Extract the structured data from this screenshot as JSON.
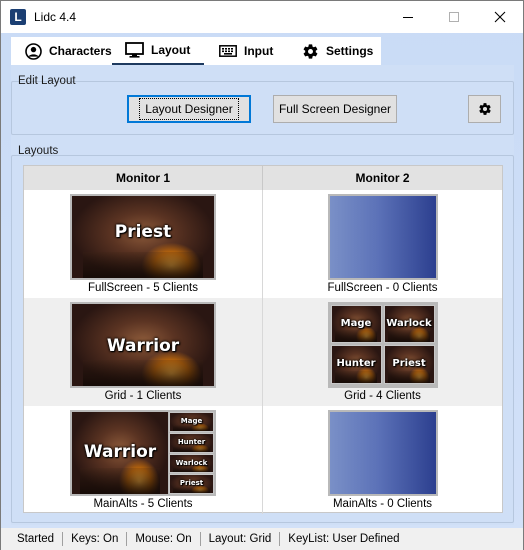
{
  "window": {
    "title": "Lidc 4.4",
    "app_icon_letter": "L"
  },
  "tabs": [
    {
      "label": "Characters",
      "icon": "user-circle-icon",
      "active": false
    },
    {
      "label": "Layout",
      "icon": "monitor-icon",
      "active": true
    },
    {
      "label": "Input",
      "icon": "keyboard-icon",
      "active": false
    },
    {
      "label": "Settings",
      "icon": "gear-icon",
      "active": false
    }
  ],
  "edit_layout": {
    "group_label": "Edit Layout",
    "layout_designer_label": "Layout Designer",
    "full_screen_designer_label": "Full Screen Designer",
    "settings_icon": "gear-icon"
  },
  "layouts": {
    "group_label": "Layouts",
    "columns": [
      "Monitor 1",
      "Monitor 2"
    ],
    "rows": [
      {
        "monitor1": {
          "caption": "FullScreen - 5 Clients",
          "labels": [
            "Priest"
          ]
        },
        "monitor2": {
          "caption": "FullScreen - 0 Clients",
          "labels": []
        }
      },
      {
        "monitor1": {
          "caption": "Grid - 1 Clients",
          "labels": [
            "Warrior"
          ]
        },
        "monitor2": {
          "caption": "Grid - 4 Clients",
          "labels": [
            "Mage",
            "Warlock",
            "Hunter",
            "Priest"
          ]
        }
      },
      {
        "monitor1": {
          "caption": "MainAlts - 5 Clients",
          "labels": [
            "Warrior",
            "Mage",
            "Hunter",
            "Warlock",
            "Priest"
          ]
        },
        "monitor2": {
          "caption": "MainAlts - 0 Clients",
          "labels": []
        }
      }
    ]
  },
  "status_bar": {
    "state": "Started",
    "keys": "Keys: On",
    "mouse": "Mouse: On",
    "layout": "Layout: Grid",
    "keylist": "KeyList: User Defined"
  }
}
